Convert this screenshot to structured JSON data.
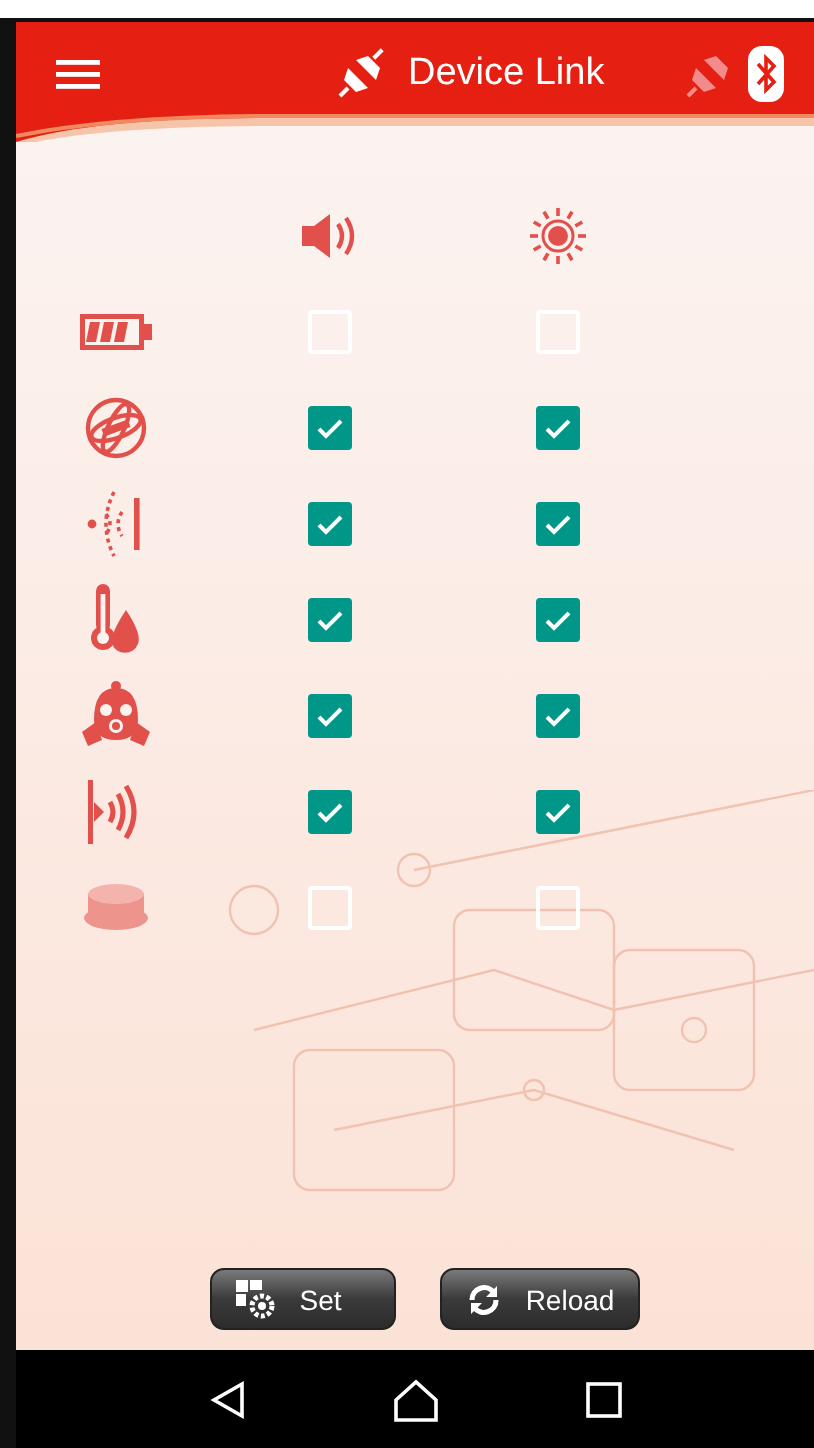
{
  "app_bar": {
    "title": "Device Link"
  },
  "columns": [
    {
      "kind": "sound"
    },
    {
      "kind": "light"
    }
  ],
  "rows": [
    {
      "kind": "battery",
      "disabled": false,
      "checks": [
        false,
        false
      ]
    },
    {
      "kind": "gyro",
      "disabled": false,
      "checks": [
        true,
        true
      ]
    },
    {
      "kind": "proximity",
      "disabled": false,
      "checks": [
        true,
        true
      ]
    },
    {
      "kind": "temperature",
      "disabled": false,
      "checks": [
        true,
        true
      ]
    },
    {
      "kind": "gas",
      "disabled": false,
      "checks": [
        true,
        true
      ]
    },
    {
      "kind": "sonar",
      "disabled": false,
      "checks": [
        true,
        true
      ]
    },
    {
      "kind": "button",
      "disabled": true,
      "checks": [
        false,
        false
      ]
    }
  ],
  "buttons": [
    {
      "kind": "set",
      "label": "Set"
    },
    {
      "kind": "reload",
      "label": "Reload"
    }
  ]
}
